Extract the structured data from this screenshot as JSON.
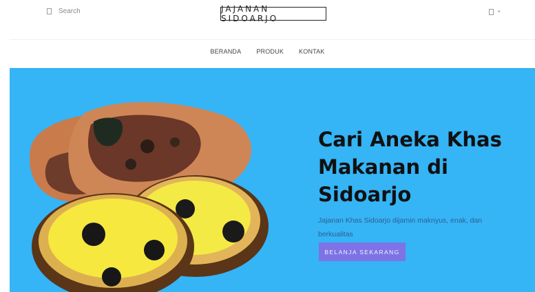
{
  "header": {
    "search_label": "Search",
    "brand": "JAJANAN SIDOARJO",
    "search_icon": "search-icon",
    "account_icon": "user-icon",
    "account_caret": "▾"
  },
  "nav": {
    "items": [
      "BERANDA",
      "PRODUK",
      "KONTAK"
    ]
  },
  "hero": {
    "title": "Cari Aneka Khas Makanan di Sidoarjo",
    "subtitle": "Jajanan Khas Sidoarjo dijamin maknyus, enak, dan berkualitas",
    "button_label": "BELANJA SEKARANG",
    "background_color": "#35b4f6",
    "button_color": "#7d73e6"
  }
}
